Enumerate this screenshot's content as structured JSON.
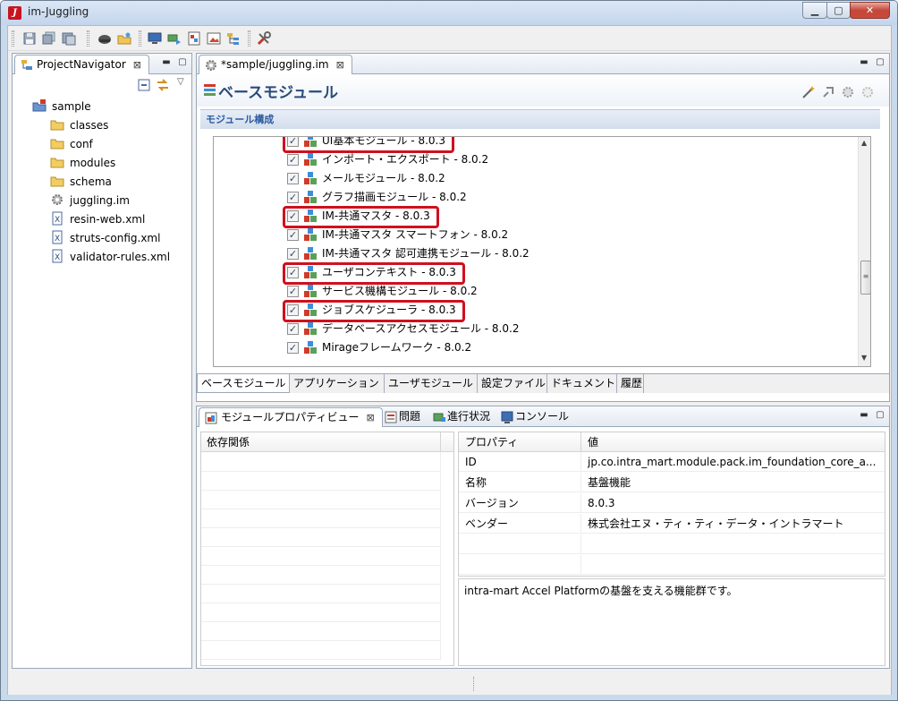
{
  "window": {
    "title": "im-Juggling"
  },
  "colors": {
    "accent": "#2b4b7a",
    "highlight": "#d0101e",
    "section_text": "#2c5aa0"
  },
  "toolbar": {
    "items": [
      "save-icon",
      "save-all-icon",
      "print-icon",
      "juggling-icon",
      "open-folder-icon",
      "monitor-icon",
      "deploy-icon",
      "export-icon",
      "image-icon",
      "tree-icon",
      "tools-icon"
    ]
  },
  "navigator": {
    "tab_label": "ProjectNavigator",
    "tree": [
      {
        "label": "sample",
        "icon": "project-icon",
        "level": 0
      },
      {
        "label": "classes",
        "icon": "folder-icon",
        "level": 1
      },
      {
        "label": "conf",
        "icon": "folder-icon",
        "level": 1
      },
      {
        "label": "modules",
        "icon": "folder-icon",
        "level": 1
      },
      {
        "label": "schema",
        "icon": "folder-icon",
        "level": 1
      },
      {
        "label": "juggling.im",
        "icon": "gear-icon",
        "level": 1
      },
      {
        "label": "resin-web.xml",
        "icon": "xml-file-icon",
        "level": 1
      },
      {
        "label": "struts-config.xml",
        "icon": "xml-file-icon",
        "level": 1
      },
      {
        "label": "validator-rules.xml",
        "icon": "xml-file-icon",
        "level": 1
      }
    ]
  },
  "editor": {
    "tab_label": "*sample/juggling.im",
    "title": "ベースモジュール",
    "section_title": "モジュール構成",
    "modules": [
      {
        "label": "UI基本モジュール - 8.0.3",
        "checked": true,
        "highlighted": true
      },
      {
        "label": "インポート・エクスポート - 8.0.2",
        "checked": true,
        "highlighted": false
      },
      {
        "label": "メールモジュール - 8.0.2",
        "checked": true,
        "highlighted": false
      },
      {
        "label": "グラフ描画モジュール - 8.0.2",
        "checked": true,
        "highlighted": false
      },
      {
        "label": "IM-共通マスタ - 8.0.3",
        "checked": true,
        "highlighted": true
      },
      {
        "label": "IM-共通マスタ スマートフォン - 8.0.2",
        "checked": true,
        "highlighted": false
      },
      {
        "label": "IM-共通マスタ 認可連携モジュール - 8.0.2",
        "checked": true,
        "highlighted": false
      },
      {
        "label": "ユーザコンテキスト - 8.0.3",
        "checked": true,
        "highlighted": true
      },
      {
        "label": "サービス機構モジュール - 8.0.2",
        "checked": true,
        "highlighted": false
      },
      {
        "label": "ジョブスケジューラ - 8.0.3",
        "checked": true,
        "highlighted": true
      },
      {
        "label": "データベースアクセスモジュール - 8.0.2",
        "checked": true,
        "highlighted": false
      },
      {
        "label": "Mirageフレームワーク - 8.0.2",
        "checked": true,
        "highlighted": false
      }
    ],
    "bottom_tabs": [
      "ベースモジュール",
      "アプリケーション",
      "ユーザモジュール",
      "設定ファイル",
      "ドキュメント",
      "履歴"
    ]
  },
  "properties_view": {
    "tabs": [
      "モジュールプロパティビュー",
      "問題",
      "進行状況",
      "コンソール"
    ],
    "dependency_header": "依存関係",
    "prop_header": "プロパティ",
    "value_header": "値",
    "rows": [
      {
        "prop": "ID",
        "value": "jp.co.intra_mart.module.pack.im_foundation_core_a..."
      },
      {
        "prop": "名称",
        "value": "基盤機能"
      },
      {
        "prop": "バージョン",
        "value": "8.0.3"
      },
      {
        "prop": "ベンダー",
        "value": "株式会社エヌ・ティ・ティ・データ・イントラマート"
      }
    ],
    "description": "intra-mart Accel Platformの基盤を支える機能群です。"
  }
}
